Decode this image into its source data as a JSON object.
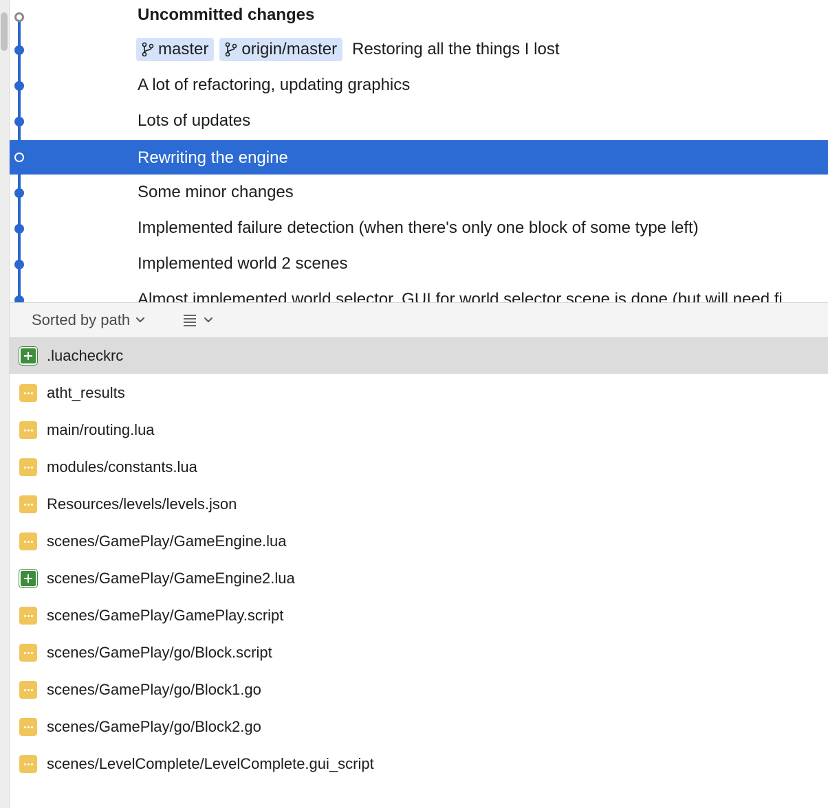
{
  "history": {
    "commits": [
      {
        "message": "Uncommitted changes",
        "uncommitted": true
      },
      {
        "branches": [
          "master",
          "origin/master"
        ],
        "message": "Restoring all the things I lost"
      },
      {
        "message": "A lot of refactoring, updating graphics"
      },
      {
        "message": "Lots of updates"
      },
      {
        "message": "Rewriting the engine",
        "selected": true
      },
      {
        "message": "Some minor changes"
      },
      {
        "message": "Implemented failure detection (when there's only one block of some type left)"
      },
      {
        "message": "Implemented world 2 scenes"
      },
      {
        "message": "Almost implemented world selector. GUI for world selector scene is done (but will need fi"
      }
    ]
  },
  "toolbar": {
    "sort_label": "Sorted by path",
    "sort_icon": "chevron-down-icon",
    "view_icon": "list-icon"
  },
  "files": [
    {
      "status": "added",
      "path": ".luacheckrc",
      "selected": true
    },
    {
      "status": "modified",
      "path": "atht_results"
    },
    {
      "status": "modified",
      "path": "main/routing.lua"
    },
    {
      "status": "modified",
      "path": "modules/constants.lua"
    },
    {
      "status": "modified",
      "path": "Resources/levels/levels.json"
    },
    {
      "status": "modified",
      "path": "scenes/GamePlay/GameEngine.lua"
    },
    {
      "status": "added",
      "path": "scenes/GamePlay/GameEngine2.lua"
    },
    {
      "status": "modified",
      "path": "scenes/GamePlay/GamePlay.script"
    },
    {
      "status": "modified",
      "path": "scenes/GamePlay/go/Block.script"
    },
    {
      "status": "modified",
      "path": "scenes/GamePlay/go/Block1.go"
    },
    {
      "status": "modified",
      "path": "scenes/GamePlay/go/Block2.go"
    },
    {
      "status": "modified",
      "path": "scenes/LevelComplete/LevelComplete.gui_script"
    }
  ],
  "colors": {
    "accent": "#2c6bd3",
    "graph": "#2a67cf",
    "added": "#3e8d3c",
    "modified": "#f0c55a",
    "branch_tag_bg": "#d5e3fa"
  }
}
